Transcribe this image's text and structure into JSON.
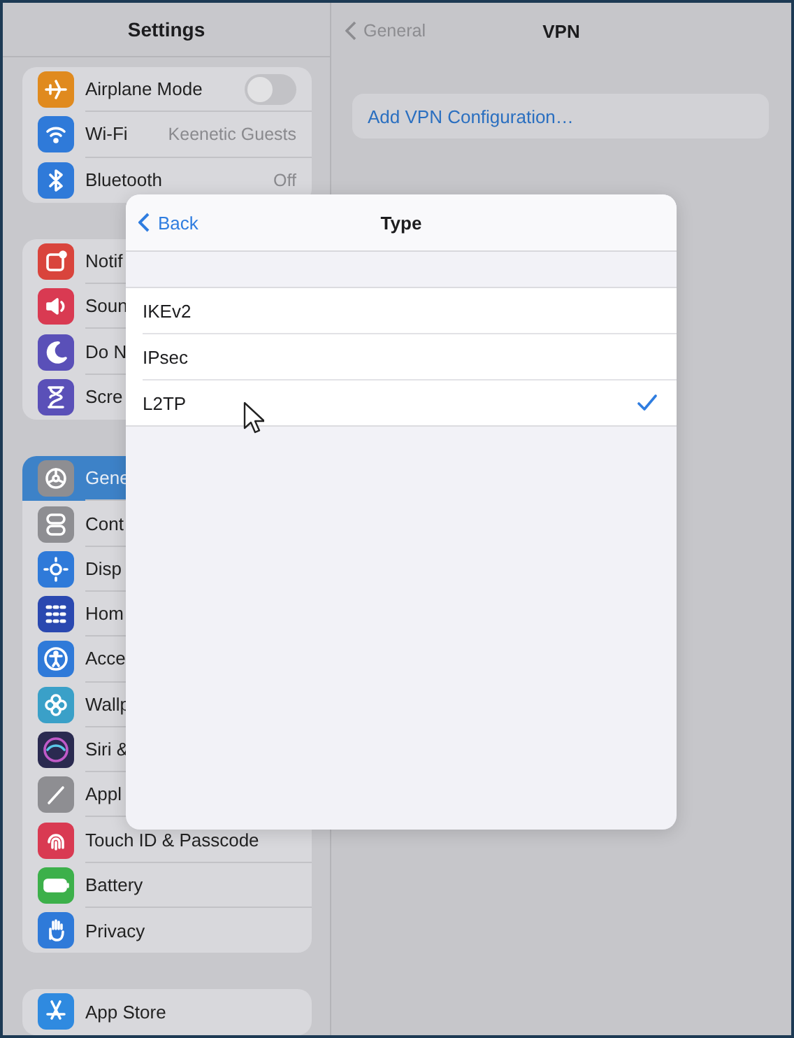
{
  "sidebar": {
    "title": "Settings",
    "groups": [
      {
        "items": [
          {
            "label": "Airplane Mode",
            "kind": "toggle",
            "on": false,
            "color": "#e08a1e",
            "selected": false
          },
          {
            "label": "Wi-Fi",
            "kind": "value",
            "value": "Keenetic Guests",
            "color": "#2f7ad9",
            "selected": false
          },
          {
            "label": "Bluetooth",
            "kind": "value",
            "value": "Off",
            "color": "#2f7ad9",
            "selected": false
          }
        ]
      },
      {
        "items": [
          {
            "label": "Notif",
            "kind": "plain",
            "color": "#d9443c",
            "selected": false
          },
          {
            "label": "Soun",
            "kind": "plain",
            "color": "#d93a52",
            "selected": false
          },
          {
            "label": "Do N",
            "kind": "plain",
            "color": "#5a50b8",
            "selected": false
          },
          {
            "label": "Scre",
            "kind": "plain",
            "color": "#5a50b8",
            "selected": false
          }
        ]
      },
      {
        "items": [
          {
            "label": "Gene",
            "kind": "plain",
            "color": "#8e8e92",
            "selected": true
          },
          {
            "label": "Cont",
            "kind": "plain",
            "color": "#8e8e92",
            "selected": false
          },
          {
            "label": "Disp",
            "kind": "plain",
            "color": "#2f7ad9",
            "selected": false
          },
          {
            "label": "Hom",
            "kind": "plain",
            "color": "#2a48b0",
            "selected": false
          },
          {
            "label": "Acce",
            "kind": "plain",
            "color": "#2f7ad9",
            "selected": false
          },
          {
            "label": "Wallp",
            "kind": "plain",
            "color": "#3aa0c8",
            "selected": false
          },
          {
            "label": "Siri &",
            "kind": "plain",
            "color": "#2a2a50",
            "selected": false
          },
          {
            "label": "Appl",
            "kind": "plain",
            "color": "#8e8e92",
            "selected": false
          },
          {
            "label": "Touch ID & Passcode",
            "kind": "plain",
            "color": "#d93a52",
            "selected": false
          },
          {
            "label": "Battery",
            "kind": "plain",
            "color": "#3cb04a",
            "selected": false
          },
          {
            "label": "Privacy",
            "kind": "plain",
            "color": "#2f7ad9",
            "selected": false
          }
        ]
      },
      {
        "items": [
          {
            "label": "App Store",
            "kind": "plain",
            "color": "#2f8ae0",
            "selected": false
          }
        ]
      }
    ]
  },
  "detail": {
    "back": "General",
    "title": "VPN",
    "action": "Add VPN Configuration…"
  },
  "sheet": {
    "back": "Back",
    "title": "Type",
    "options": [
      {
        "label": "IKEv2",
        "selected": false
      },
      {
        "label": "IPsec",
        "selected": false
      },
      {
        "label": "L2TP",
        "selected": true
      }
    ]
  }
}
